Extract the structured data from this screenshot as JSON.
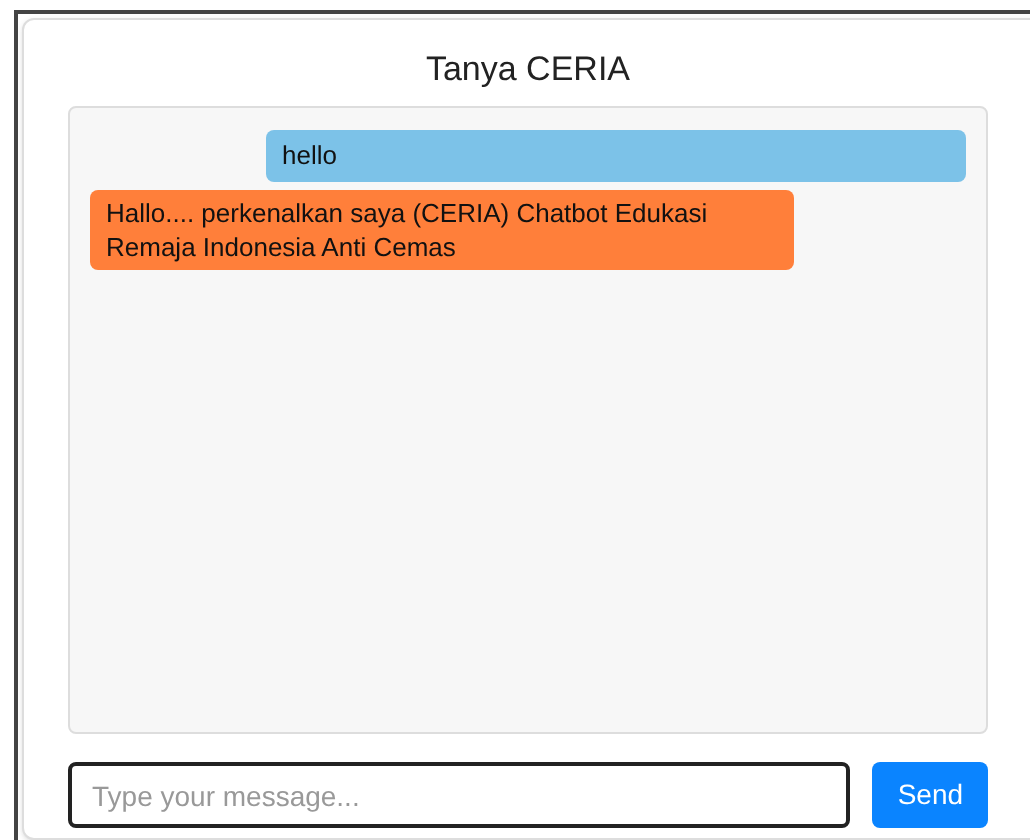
{
  "title": "Tanya CERIA",
  "messages": [
    {
      "kind": "user",
      "text": "hello"
    },
    {
      "kind": "bot",
      "text": "Hallo.... perkenalkan saya (CERIA) Chatbot Edukasi Remaja Indonesia Anti Cemas"
    }
  ],
  "input": {
    "placeholder": "Type your message..."
  },
  "send_button": "Send"
}
